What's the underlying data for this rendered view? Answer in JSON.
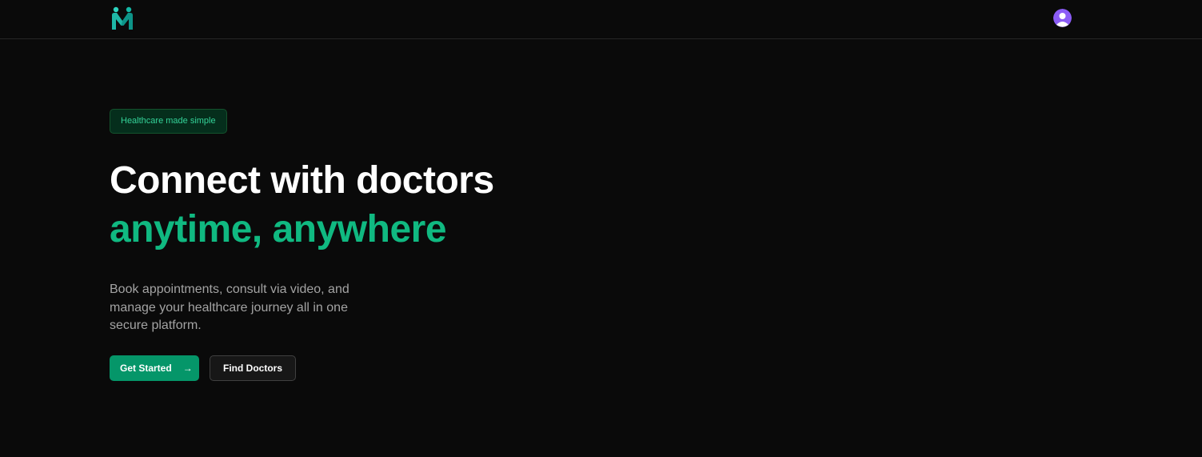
{
  "navbar": {
    "logo_icon": "medimeet-logo-icon",
    "avatar_icon": "user-avatar-icon"
  },
  "hero": {
    "badge": "Healthcare made simple",
    "title_line1": "Connect with doctors",
    "title_line2": "anytime, anywhere",
    "subtitle": "Book appointments, consult via video, and manage your healthcare journey all in one secure platform.",
    "primary_button": "Get Started",
    "primary_button_icon": "arrow-right-icon",
    "secondary_button": "Find Doctors"
  },
  "colors": {
    "background": "#0a0a0a",
    "accent": "#10b981",
    "primary_button": "#059669",
    "badge_text": "#34d399",
    "avatar": "#8b5cf6"
  }
}
